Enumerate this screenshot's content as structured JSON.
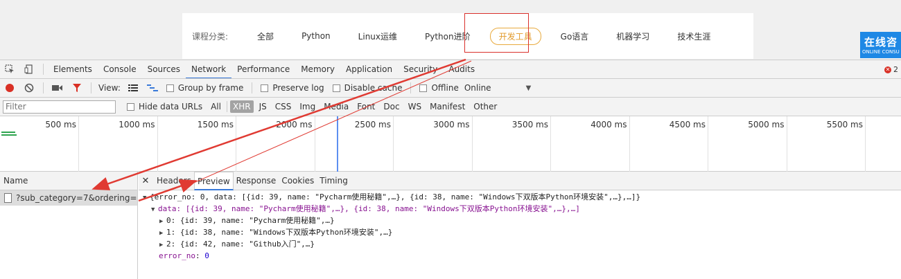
{
  "site": {
    "category_label": "课程分类:",
    "categories": [
      "全部",
      "Python",
      "Linux运维",
      "Python进阶",
      "开发工具",
      "Go语言",
      "机器学习",
      "技术生涯"
    ],
    "active_category": "开发工具",
    "consult_big": "在线咨",
    "consult_small": "ONLINE CONSU"
  },
  "devtools": {
    "tabs": [
      "Elements",
      "Console",
      "Sources",
      "Network",
      "Performance",
      "Memory",
      "Application",
      "Security",
      "Audits"
    ],
    "active_tab": "Network",
    "error_count": "2",
    "toolbar": {
      "view_label": "View:",
      "group_by_frame": "Group by frame",
      "preserve_log": "Preserve log",
      "disable_cache": "Disable cache",
      "offline": "Offline",
      "throttle": "Online"
    },
    "filter": {
      "placeholder": "Filter",
      "hide_data_urls": "Hide data URLs",
      "types": [
        "All",
        "XHR",
        "JS",
        "CSS",
        "Img",
        "Media",
        "Font",
        "Doc",
        "WS",
        "Manifest",
        "Other"
      ],
      "active_type": "XHR"
    },
    "timeline_ticks": [
      "500 ms",
      "1000 ms",
      "1500 ms",
      "2000 ms",
      "2500 ms",
      "3000 ms",
      "3500 ms",
      "4000 ms",
      "4500 ms",
      "5000 ms",
      "5500 ms"
    ],
    "requests": {
      "header": "Name",
      "items": [
        "?sub_category=7&ordering="
      ]
    },
    "detail_tabs": [
      "Headers",
      "Preview",
      "Response",
      "Cookies",
      "Timing"
    ],
    "active_detail_tab": "Preview",
    "preview": {
      "root": "{error_no: 0, data: [{id: 39, name: \"Pycharm使用秘籍\",…}, {id: 38, name: \"Windows下双版本Python环境安装\",…},…]}",
      "data_line": "data: [{id: 39, name: \"Pycharm使用秘籍\",…}, {id: 38, name: \"Windows下双版本Python环境安装\",…},…]",
      "items": [
        "0: {id: 39, name: \"Pycharm使用秘籍\",…}",
        "1: {id: 38, name: \"Windows下双版本Python环境安装\",…}",
        "2: {id: 42, name: \"Github入门\",…}"
      ],
      "error_no_key": "error_no",
      "error_no_value": "0"
    }
  }
}
